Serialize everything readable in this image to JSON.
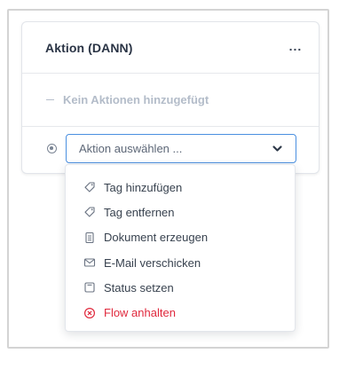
{
  "card": {
    "title": "Aktion (DANN)",
    "more_label": "...",
    "empty_text": "Kein Aktionen hinzugefügt"
  },
  "select": {
    "placeholder": "Aktion auswählen ..."
  },
  "menu": {
    "items": [
      {
        "label": "Tag hinzufügen",
        "icon": "tag-icon"
      },
      {
        "label": "Tag entfernen",
        "icon": "tag-icon"
      },
      {
        "label": "Dokument erzeugen",
        "icon": "document-icon"
      },
      {
        "label": "E-Mail verschicken",
        "icon": "mail-icon"
      },
      {
        "label": "Status setzen",
        "icon": "status-icon"
      },
      {
        "label": "Flow anhalten",
        "icon": "stop-circle-icon"
      }
    ]
  },
  "colors": {
    "accent": "#4a8fe0",
    "danger": "#e0293d",
    "muted": "#b3bcc9"
  }
}
